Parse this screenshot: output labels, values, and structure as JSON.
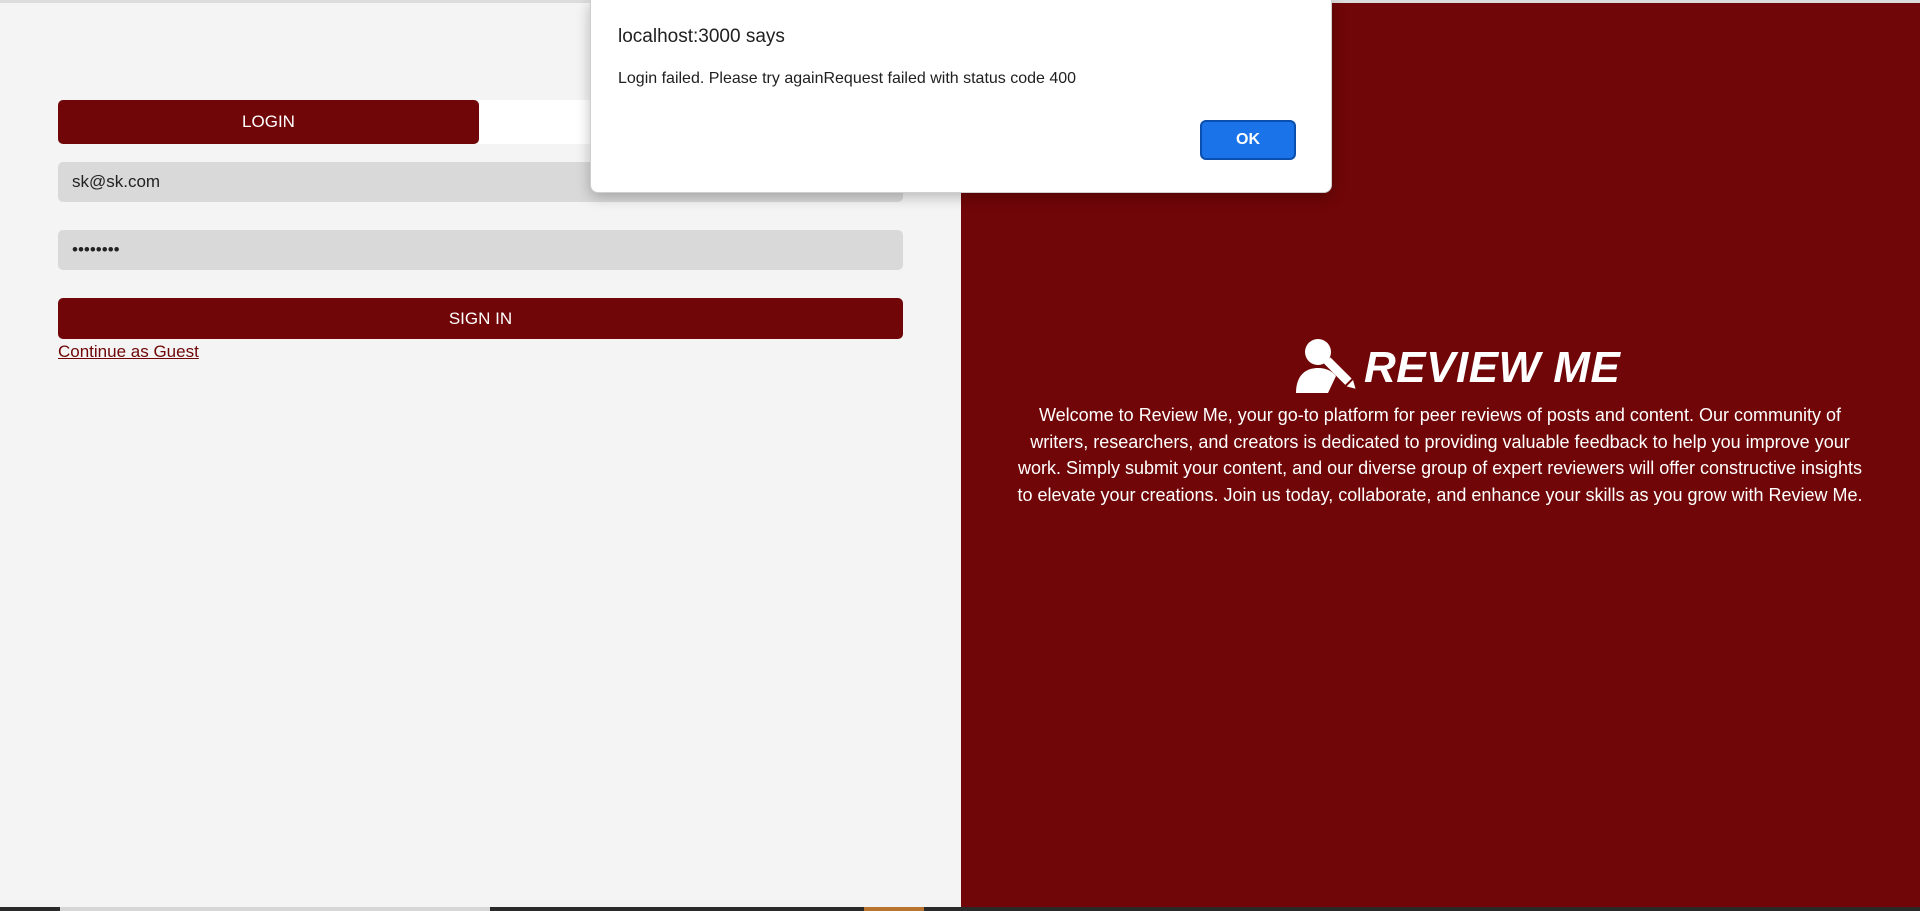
{
  "login_panel": {
    "tab_login_label": "LOGIN",
    "email_value": "sk@sk.com",
    "password_value": "password",
    "signin_label": "SIGN IN",
    "guest_link": "Continue as Guest"
  },
  "brand": {
    "icon": "user-pen-icon",
    "title": "REVIEW ME",
    "description": "Welcome to Review Me, your go-to platform for peer reviews of posts and content. Our community of writers, researchers, and creators is dedicated to providing valuable feedback to help you improve your work. Simply submit your content, and our diverse group of expert reviewers will offer constructive insights to elevate your creations. Join us today, collaborate, and enhance your skills as you grow with Review Me."
  },
  "alert_dialog": {
    "title": "localhost:3000 says",
    "message": "Login failed. Please try againRequest failed with status code 400",
    "ok_label": "OK"
  },
  "colors": {
    "brand_maroon": "#700607",
    "left_background": "#f4f4f4",
    "input_background": "#d9d9d9",
    "ok_button_blue": "#1a73e8"
  }
}
